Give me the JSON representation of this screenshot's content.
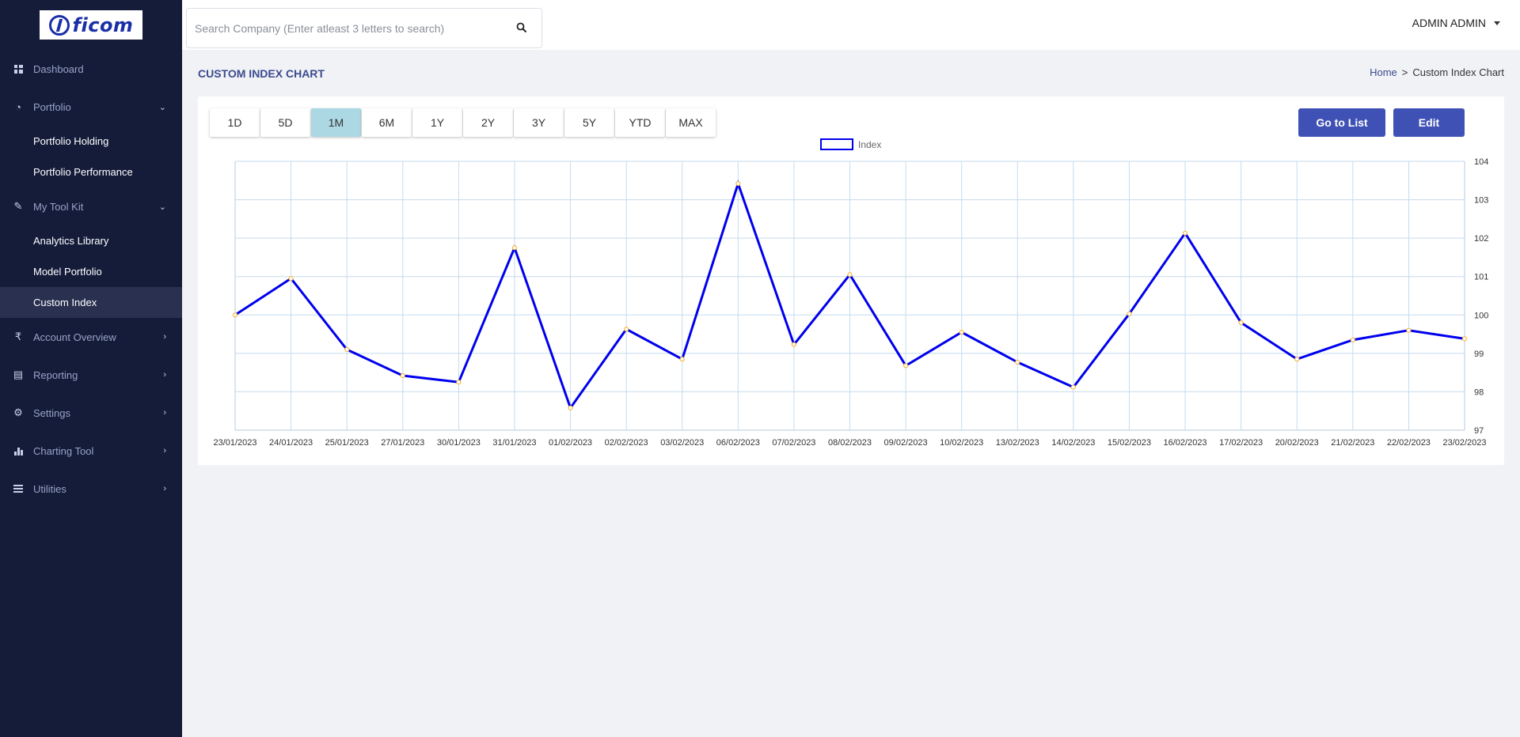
{
  "brand": {
    "logo_text": "ficom"
  },
  "sidebar": {
    "items": [
      {
        "label": "Dashboard",
        "icon": "dashboard-icon"
      },
      {
        "label": "Portfolio",
        "icon": "portfolio-icon",
        "expanded": true,
        "children": [
          {
            "label": "Portfolio Holding"
          },
          {
            "label": "Portfolio Performance"
          }
        ]
      },
      {
        "label": "My Tool Kit",
        "icon": "toolkit-icon",
        "expanded": true,
        "children": [
          {
            "label": "Analytics Library"
          },
          {
            "label": "Model Portfolio"
          },
          {
            "label": "Custom Index",
            "active": true
          }
        ]
      },
      {
        "label": "Account Overview",
        "icon": "rupee-icon"
      },
      {
        "label": "Reporting",
        "icon": "report-icon"
      },
      {
        "label": "Settings",
        "icon": "gear-icon"
      },
      {
        "label": "Charting Tool",
        "icon": "bar-chart-icon"
      },
      {
        "label": "Utilities",
        "icon": "menu-icon"
      }
    ]
  },
  "header": {
    "search_placeholder": "Search Company (Enter atleast 3 letters to search)",
    "user_name": "ADMIN ADMIN"
  },
  "page": {
    "title": "CUSTOM INDEX CHART",
    "breadcrumb": {
      "home": "Home",
      "separator": ">",
      "current": "Custom Index Chart"
    }
  },
  "toolbar": {
    "ranges": [
      "1D",
      "5D",
      "1M",
      "6M",
      "1Y",
      "2Y",
      "3Y",
      "5Y",
      "YTD",
      "MAX"
    ],
    "active_range": "1M",
    "go_to_list": "Go to List",
    "edit": "Edit"
  },
  "colors": {
    "line": "#0000ee",
    "marker": "#f5b942",
    "grid": "#c5dbef",
    "accent": "#3f51b5",
    "active_range": "#acd8e4"
  },
  "chart_data": {
    "type": "line",
    "legend": "Index",
    "legend_position": "top-center",
    "grid": true,
    "y_axis_position": "right",
    "ylim": [
      97,
      104
    ],
    "yticks": [
      97,
      98,
      99,
      100,
      101,
      102,
      103,
      104
    ],
    "x": [
      "23/01/2023",
      "24/01/2023",
      "25/01/2023",
      "27/01/2023",
      "30/01/2023",
      "31/01/2023",
      "01/02/2023",
      "02/02/2023",
      "03/02/2023",
      "06/02/2023",
      "07/02/2023",
      "08/02/2023",
      "09/02/2023",
      "10/02/2023",
      "13/02/2023",
      "14/02/2023",
      "15/02/2023",
      "16/02/2023",
      "17/02/2023",
      "20/02/2023",
      "21/02/2023",
      "22/02/2023",
      "23/02/2023"
    ],
    "series": [
      {
        "name": "Index",
        "values": [
          100.0,
          100.95,
          99.1,
          98.42,
          98.25,
          101.75,
          97.58,
          99.63,
          98.85,
          103.42,
          99.23,
          101.05,
          98.68,
          99.55,
          98.77,
          98.12,
          100.03,
          102.13,
          99.8,
          98.85,
          99.35,
          99.6,
          99.38
        ]
      }
    ]
  }
}
